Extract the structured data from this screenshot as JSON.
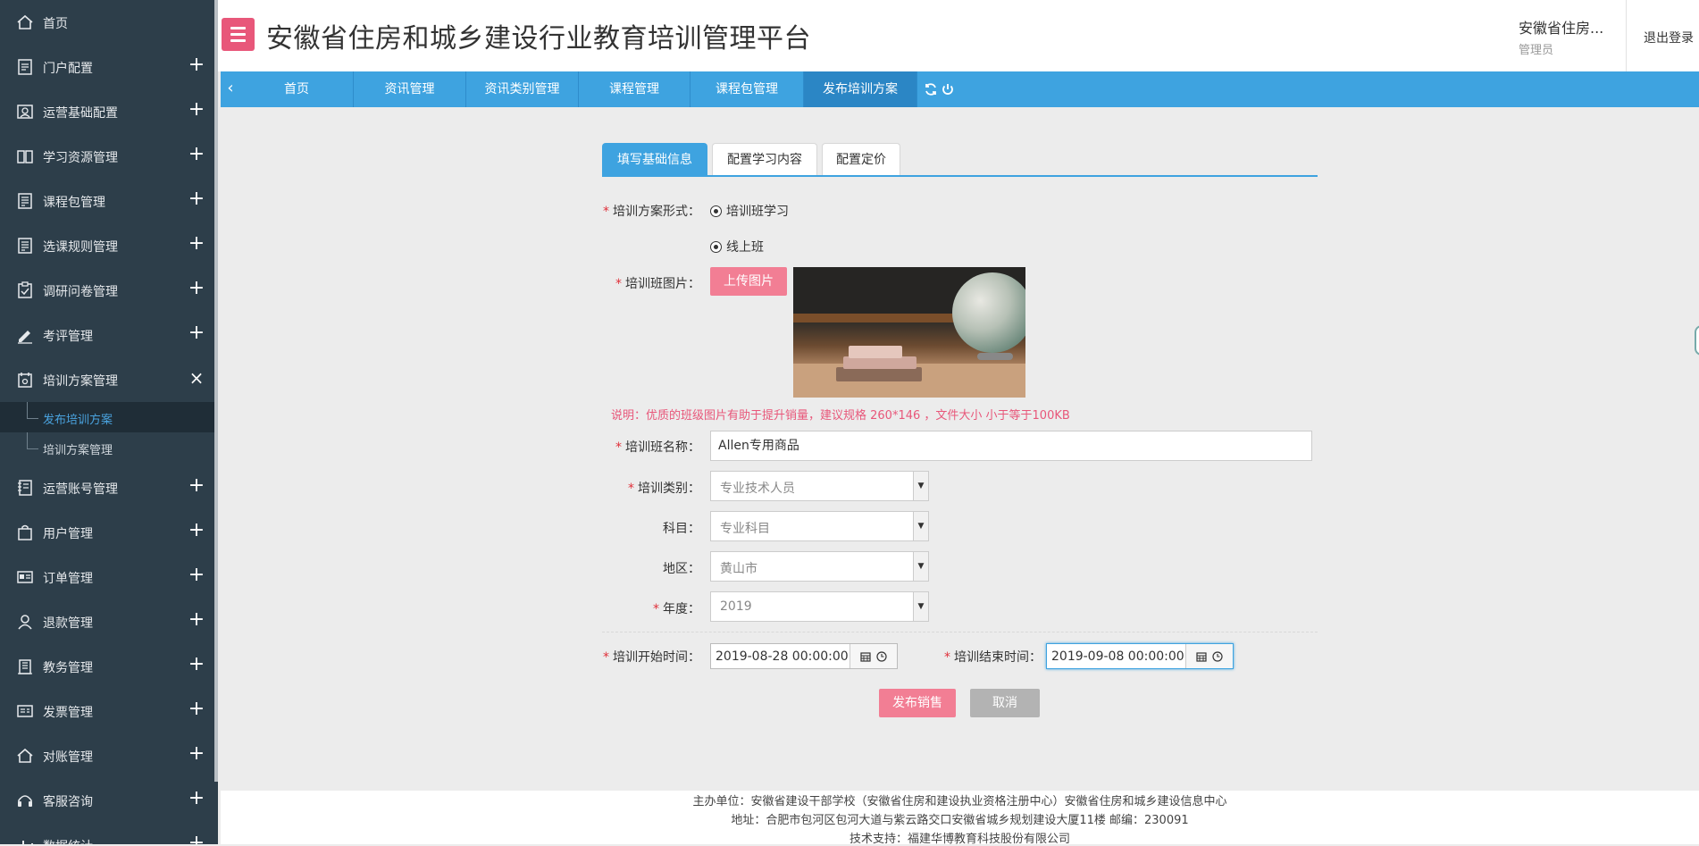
{
  "header": {
    "title": "安徽省住房和城乡建设行业教育培训管理平台",
    "user_name": "安徽省住房...",
    "user_role": "管理员",
    "logout_label": "退出登录",
    "accent_color": "#e8577a",
    "brand_blue": "#3ea3e0"
  },
  "sidebar": {
    "items": [
      {
        "label": "首页",
        "icon": "home-icon",
        "toggle": ""
      },
      {
        "label": "门户配置",
        "icon": "document-icon",
        "toggle": "+"
      },
      {
        "label": "运营基础配置",
        "icon": "profile-card-icon",
        "toggle": "+"
      },
      {
        "label": "学习资源管理",
        "icon": "book-icon",
        "toggle": "+"
      },
      {
        "label": "课程包管理",
        "icon": "list-icon",
        "toggle": "+"
      },
      {
        "label": "选课规则管理",
        "icon": "list-icon",
        "toggle": "+"
      },
      {
        "label": "调研问卷管理",
        "icon": "clipboard-check-icon",
        "toggle": "+"
      },
      {
        "label": "考评管理",
        "icon": "pen-icon",
        "toggle": "+"
      },
      {
        "label": "培训方案管理",
        "icon": "calendar-gear-icon",
        "toggle": "×"
      },
      {
        "label": "运营账号管理",
        "icon": "ledger-icon",
        "toggle": "+"
      },
      {
        "label": "用户管理",
        "icon": "bag-icon",
        "toggle": "+"
      },
      {
        "label": "订单管理",
        "icon": "id-card-icon",
        "toggle": "+"
      },
      {
        "label": "退款管理",
        "icon": "user-pin-icon",
        "toggle": "+"
      },
      {
        "label": "教务管理",
        "icon": "building-icon",
        "toggle": "+"
      },
      {
        "label": "发票管理",
        "icon": "invoice-icon",
        "toggle": "+"
      },
      {
        "label": "对账管理",
        "icon": "home-icon",
        "toggle": "+"
      },
      {
        "label": "客服咨询",
        "icon": "headset-icon",
        "toggle": "+"
      },
      {
        "label": "数据统计",
        "icon": "chart-icon",
        "toggle": "+"
      }
    ],
    "sub_items": [
      {
        "label": "发布培训方案",
        "active": true
      },
      {
        "label": "培训方案管理",
        "active": false
      }
    ]
  },
  "tabs": {
    "items": [
      "首页",
      "资讯管理",
      "资讯类别管理",
      "课程管理",
      "课程包管理",
      "发布培训方案"
    ],
    "active_index": 5
  },
  "form": {
    "tabs": [
      "填写基础信息",
      "配置学习内容",
      "配置定价"
    ],
    "active_tab": 0,
    "scheme_form_label": "培训方案形式：",
    "radio_options": [
      "培训班学习",
      "线上班"
    ],
    "image_label": "培训班图片：",
    "upload_label": "上传图片",
    "note": "说明：优质的班级图片有助于提升销量，建议规格 260*146 ，文件大小 小于等于100KB",
    "name_label": "培训班名称：",
    "name_value": "Allen专用商品",
    "category_label": "培训类别：",
    "category_value": "专业技术人员",
    "subject_label": "科目：",
    "subject_value": "专业科目",
    "region_label": "地区：",
    "region_value": "黄山市",
    "year_label": "年度：",
    "year_value": "2019",
    "start_label": "培训开始时间：",
    "start_value": "2019-08-28 00:00:00",
    "end_label": "培训结束时间：",
    "end_value": "2019-09-08 00:00:00",
    "publish_label": "发布销售",
    "cancel_label": "取消",
    "required_mark": "*"
  },
  "footer": {
    "line1": "主办单位：安徽省建设干部学校（安徽省住房和建设执业资格注册中心）安徽省住房和城乡建设信息中心",
    "line2": "地址：合肥市包河区包河大道与紫云路交口安徽省城乡规划建设大厦11楼 邮编：230091",
    "line3": "技术支持：福建华博教育科技股份有限公司"
  }
}
